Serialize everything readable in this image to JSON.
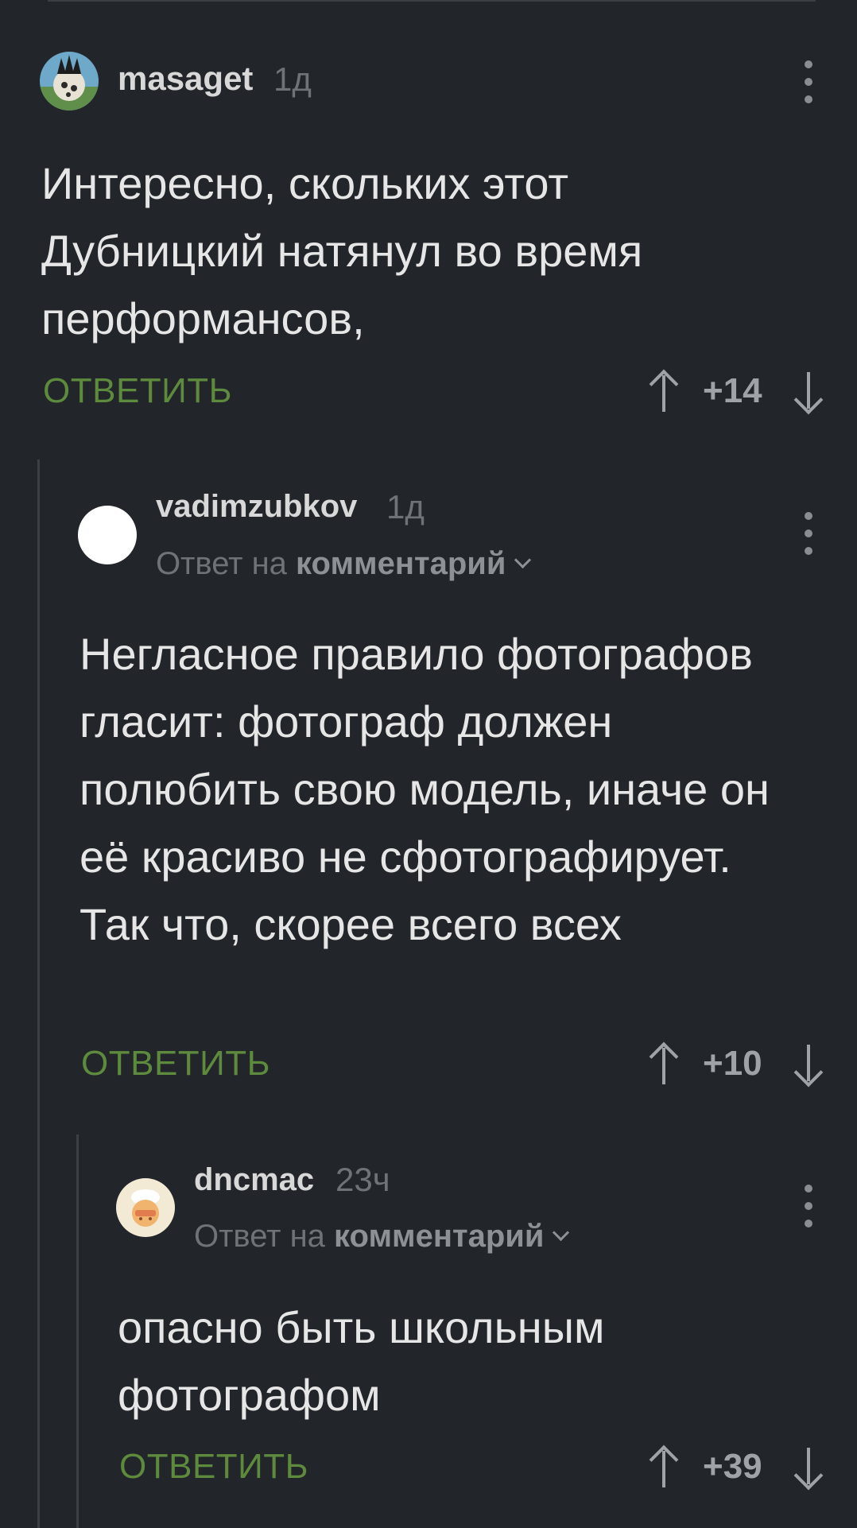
{
  "comments": [
    {
      "username": "masaget",
      "time": "1д",
      "text": "Интересно, скольких этот Дубницкий натянул во время перформансов,",
      "reply_label": "ОТВЕТИТЬ",
      "score": "+14"
    },
    {
      "username": "vadimzubkov",
      "time": "1д",
      "reply_prefix": "Ответ на",
      "reply_target": "комментарий",
      "text": "Негласное правило фотографов гласит: фотограф должен полюбить свою модель, иначе он её красиво не сфотографирует. Так что, скорее всего всех",
      "reply_label": "ОТВЕТИТЬ",
      "score": "+10"
    },
    {
      "username": "dncmac",
      "time": "23ч",
      "reply_prefix": "Ответ на",
      "reply_target": "комментарий",
      "text": "опасно быть школьным фотографом",
      "reply_label": "ОТВЕТИТЬ",
      "score": "+39"
    }
  ],
  "icons": {
    "more": "more-vertical-icon",
    "upvote": "arrow-up-icon",
    "downvote": "arrow-down-icon",
    "expand": "chevron-down-icon"
  },
  "colors": {
    "background": "#222529",
    "reply_button": "#5d8a3c",
    "muted_text": "#6f7378"
  }
}
